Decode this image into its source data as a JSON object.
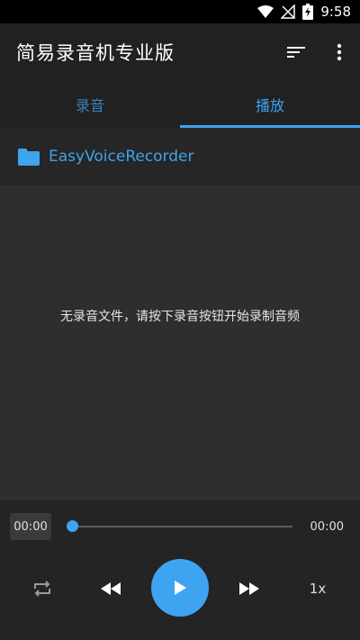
{
  "status_bar": {
    "time": "9:58",
    "icons": [
      "wifi-icon",
      "no-signal-icon",
      "battery-charging-icon"
    ]
  },
  "app_bar": {
    "title": "简易录音机专业版",
    "actions": [
      "sort-icon",
      "more-vert-icon"
    ]
  },
  "tabs": [
    {
      "label": "录音",
      "active": false
    },
    {
      "label": "播放",
      "active": true
    }
  ],
  "folder": {
    "icon": "folder-icon",
    "name": "EasyVoiceRecorder"
  },
  "content": {
    "empty_message": "无录音文件，请按下录音按钮开始录制音频"
  },
  "player": {
    "current_time": "00:00",
    "total_time": "00:00",
    "progress": 0,
    "speed": "1x",
    "controls": [
      "repeat-icon",
      "rewind-icon",
      "play-icon",
      "fast-forward-icon"
    ]
  },
  "colors": {
    "accent": "#3ea4f0",
    "app_bar_bg": "#212121",
    "content_bg": "#2e2e2e",
    "status_bar_bg": "#000000"
  }
}
